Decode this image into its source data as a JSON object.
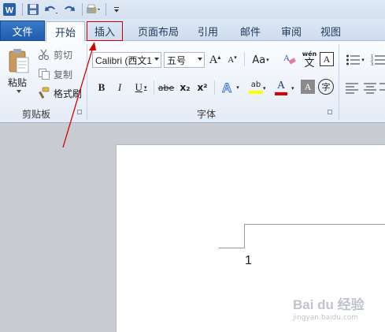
{
  "quick_access": {
    "word_logo": "W",
    "icons": [
      "word-app-icon",
      "save-icon",
      "undo-icon",
      "redo-icon",
      "print-preview-icon",
      "customize-qat-icon"
    ]
  },
  "tabs": [
    {
      "label": "文件"
    },
    {
      "label": "开始"
    },
    {
      "label": "插入"
    },
    {
      "label": "页面布局"
    },
    {
      "label": "引用"
    },
    {
      "label": "邮件"
    },
    {
      "label": "审阅"
    },
    {
      "label": "视图"
    }
  ],
  "clipboard": {
    "paste_label": "粘贴",
    "cut_label": "剪切",
    "copy_label": "复制",
    "format_painter_label": "格式刷",
    "group_label": "剪贴板"
  },
  "font": {
    "font_name": "Calibri (西文1",
    "font_size": "五号",
    "group_label": "字体",
    "grow_label": "A",
    "shrink_label": "A",
    "change_case_label": "Aa",
    "pinyin_label": "wén",
    "border_char_label": "A",
    "bold_label": "B",
    "italic_label": "I",
    "underline_label": "U",
    "strike_label": "abe",
    "subscript_label": "x₂",
    "superscript_label": "x²",
    "effects_label": "A",
    "highlight_label": "ab",
    "color_label": "A",
    "shade_label": "A",
    "enclose_label": "字"
  },
  "document": {
    "page_number": "1"
  },
  "colors": {
    "file_tab": "#2a67b8",
    "highlight_box": "#d40000",
    "annotation_arrow": "#d40000",
    "font_color_bar": "#e00000",
    "highlight_color_bar": "#ffff00"
  },
  "watermark": {
    "brand": "Bai du 经验",
    "url": "jingyan.baidu.com"
  }
}
